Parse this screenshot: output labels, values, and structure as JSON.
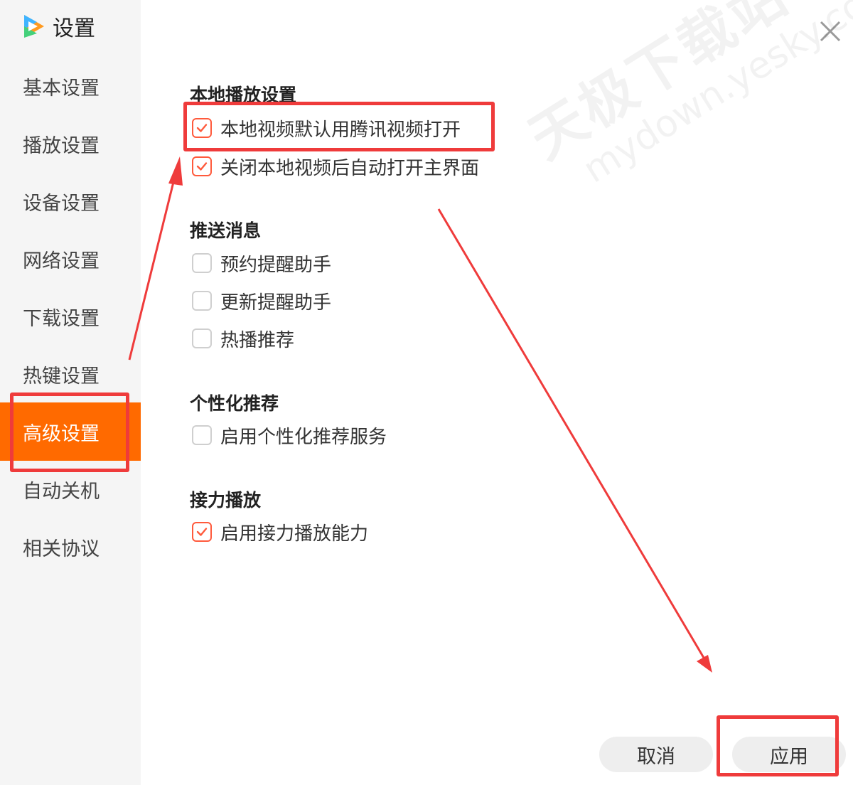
{
  "window": {
    "title": "设置",
    "close_icon": "close-icon"
  },
  "sidebar": {
    "items": [
      {
        "label": "基本设置",
        "active": false
      },
      {
        "label": "播放设置",
        "active": false
      },
      {
        "label": "设备设置",
        "active": false
      },
      {
        "label": "网络设置",
        "active": false
      },
      {
        "label": "下载设置",
        "active": false
      },
      {
        "label": "热键设置",
        "active": false
      },
      {
        "label": "高级设置",
        "active": true
      },
      {
        "label": "自动关机",
        "active": false
      },
      {
        "label": "相关协议",
        "active": false
      }
    ]
  },
  "sections": {
    "local_play": {
      "title": "本地播放设置",
      "options": [
        {
          "label": "本地视频默认用腾讯视频打开",
          "checked": true
        },
        {
          "label": "关闭本地视频后自动打开主界面",
          "checked": true
        }
      ]
    },
    "push": {
      "title": "推送消息",
      "options": [
        {
          "label": "预约提醒助手",
          "checked": false
        },
        {
          "label": "更新提醒助手",
          "checked": false
        },
        {
          "label": "热播推荐",
          "checked": false
        }
      ]
    },
    "personalized": {
      "title": "个性化推荐",
      "options": [
        {
          "label": "启用个性化推荐服务",
          "checked": false
        }
      ]
    },
    "relay": {
      "title": "接力播放",
      "options": [
        {
          "label": "启用接力播放能力",
          "checked": true
        }
      ]
    }
  },
  "footer": {
    "cancel_label": "取消",
    "apply_label": "应用"
  },
  "watermark": {
    "main": "天极下载站",
    "sub": "mydown.yesky.com"
  },
  "colors": {
    "accent": "#ff6a00",
    "annotation": "#ef3b3b",
    "checkbox_checked": "#ff5a3c"
  }
}
